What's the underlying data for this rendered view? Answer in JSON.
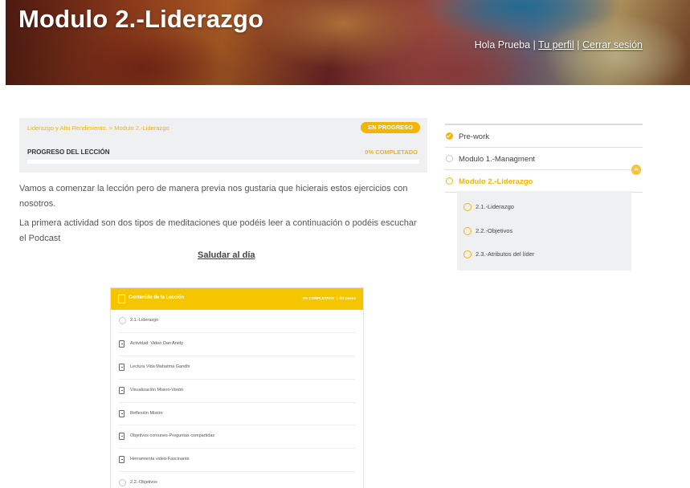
{
  "header": {
    "title": "Modulo 2.-Liderazgo",
    "greeting": "Hola Prueba",
    "profile_link": "Tu perfil",
    "logout_link": "Cerrar sesión",
    "separator": "|"
  },
  "progress": {
    "breadcrumb_course": "Liderazgo y Alto Rendimiento.",
    "breadcrumb_sep": ">",
    "breadcrumb_module": "Modulo 2.-Liderazgo",
    "status_badge": "EN PROGRESO",
    "label": "PROGRESO DEL LECCIÓN",
    "percent_text": "0% COMPLETADO",
    "percent_value": 0
  },
  "intro": {
    "paragraph_1": "Vamos a comenzar la lección pero de manera previa nos gustaria que hicierais estos ejercicios con nosotros.",
    "paragraph_2": "La primera actividad son dos tipos de meditaciones que podéis leer a continuación o podéis escuchar el Podcast",
    "link": "Saludar al día"
  },
  "lesson_content": {
    "title": "Contenido de la Lección",
    "completed_text": "0% COMPLETADO",
    "separator": "|",
    "steps_text": "0/2 pasos",
    "items": [
      {
        "label": "2.1.-Liderazgo",
        "icon": "circle"
      },
      {
        "label": "Actividad: Video Dan Ariely",
        "icon": "document"
      },
      {
        "label": "Lectura Vida Mahatma Gandhi",
        "icon": "document"
      },
      {
        "label": "Visualización Mision-Visión",
        "icon": "document"
      },
      {
        "label": "Reflexión Misión",
        "icon": "document"
      },
      {
        "label": "Objetivos comunes-Preguntas compartidas",
        "icon": "document"
      },
      {
        "label": "Herramienta video-Fascinante",
        "icon": "document"
      },
      {
        "label": "2.2.-Objetivos",
        "icon": "circle"
      }
    ]
  },
  "sidebar": {
    "items": [
      {
        "label": "Pre-work",
        "state": "done"
      },
      {
        "label": "Modulo 1.-Managment",
        "state": "collapsed"
      },
      {
        "label": "Modulo 2.-Liderazgo",
        "state": "expanded"
      }
    ],
    "sub_items": [
      {
        "label": "2.1.-Liderazgo"
      },
      {
        "label": "2.2.-Objetivos"
      },
      {
        "label": "2.3.-Atributos del líder"
      }
    ]
  },
  "colors": {
    "accent": "#f5b400",
    "card_header": "#f5c500",
    "panel_bg": "#eef0f2"
  }
}
